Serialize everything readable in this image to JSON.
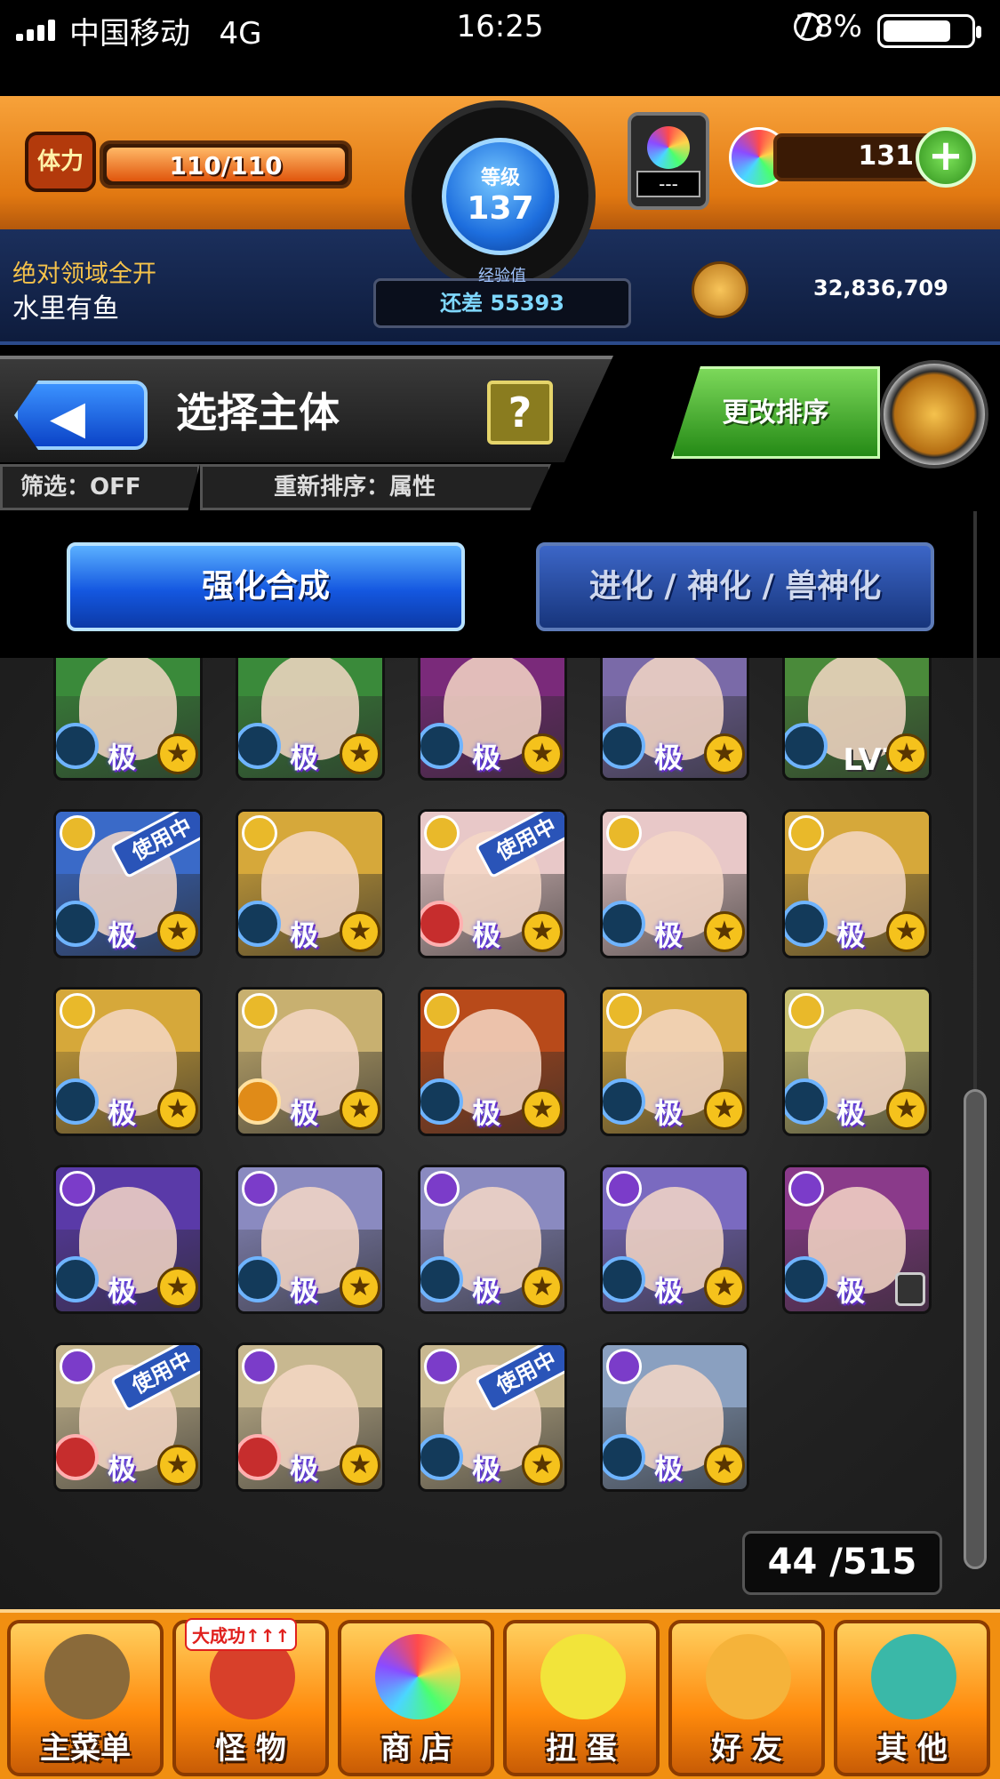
{
  "status_bar": {
    "carrier": "中国移动",
    "network": "4G",
    "time": "16:25",
    "battery": "78%",
    "battery_level": 0.78
  },
  "header": {
    "stamina_label": "体力",
    "stamina": "110/110",
    "stamina_level": 1.0,
    "rank_label": "等级",
    "rank": "137",
    "exp_label": "经验值",
    "exp_remaining": "还差 55393",
    "guild": "绝对领域全开",
    "player_name": "水里有鱼",
    "orb_box": "---",
    "orb_count": "131",
    "gold": "32,836,709"
  },
  "title_bar": {
    "title": "选择主体",
    "help": "?",
    "filter": "筛选：OFF",
    "sort_order": "重新排序：属性",
    "change_sort": "更改排序"
  },
  "tabs": [
    {
      "label": "强化合成",
      "active": true
    },
    {
      "label": "进化 / 神化 / 兽神化",
      "active": false
    }
  ],
  "monsters": [
    {
      "elem": "none",
      "color": "#3a8a3a",
      "lucky": "blue",
      "ji": "极",
      "inuse": false,
      "lv": ""
    },
    {
      "elem": "none",
      "color": "#3a8a3a",
      "lucky": "blue",
      "ji": "极",
      "inuse": false,
      "lv": ""
    },
    {
      "elem": "none",
      "color": "#7a2a7a",
      "lucky": "blue",
      "ji": "极",
      "inuse": false,
      "lv": ""
    },
    {
      "elem": "none",
      "color": "#7a6aa8",
      "lucky": "blue",
      "ji": "极",
      "inuse": false,
      "lv": ""
    },
    {
      "elem": "none",
      "color": "#4a8a3a",
      "lucky": "blue",
      "ji": "",
      "inuse": false,
      "lv": "LV70"
    },
    {
      "elem": "light",
      "color": "#3a6ac8",
      "lucky": "blue",
      "ji": "极",
      "inuse": true,
      "lv": ""
    },
    {
      "elem": "light",
      "color": "#d6a83a",
      "lucky": "blue",
      "ji": "极",
      "inuse": false,
      "lv": ""
    },
    {
      "elem": "light",
      "color": "#e8c8c8",
      "lucky": "fruit",
      "ji": "极",
      "inuse": true,
      "lv": ""
    },
    {
      "elem": "light",
      "color": "#e8c8c8",
      "lucky": "blue",
      "ji": "极",
      "inuse": false,
      "lv": ""
    },
    {
      "elem": "light",
      "color": "#d6a83a",
      "lucky": "blue",
      "ji": "极",
      "inuse": false,
      "lv": ""
    },
    {
      "elem": "light",
      "color": "#d6a83a",
      "lucky": "blue",
      "ji": "极",
      "inuse": false,
      "lv": ""
    },
    {
      "elem": "light",
      "color": "#c8b070",
      "lucky": "pear",
      "ji": "极",
      "inuse": false,
      "lv": ""
    },
    {
      "elem": "light",
      "color": "#b84a1a",
      "lucky": "blue",
      "ji": "极",
      "inuse": false,
      "lv": ""
    },
    {
      "elem": "light",
      "color": "#d6a83a",
      "lucky": "blue",
      "ji": "极",
      "inuse": false,
      "lv": ""
    },
    {
      "elem": "light",
      "color": "#c8c070",
      "lucky": "blue",
      "ji": "极",
      "inuse": false,
      "lv": ""
    },
    {
      "elem": "dark",
      "color": "#5a3aa8",
      "lucky": "blue",
      "ji": "极",
      "inuse": false,
      "lv": ""
    },
    {
      "elem": "dark",
      "color": "#8a8ac0",
      "lucky": "blue",
      "ji": "极",
      "inuse": false,
      "lv": ""
    },
    {
      "elem": "dark",
      "color": "#8a8ac0",
      "lucky": "blue",
      "ji": "极",
      "inuse": false,
      "lv": ""
    },
    {
      "elem": "dark",
      "color": "#7a6ac0",
      "lucky": "blue",
      "ji": "极",
      "inuse": false,
      "lv": ""
    },
    {
      "elem": "dark",
      "color": "#8a3a8a",
      "lucky": "blue",
      "ji": "极",
      "inuse": false,
      "lv": "",
      "locked": true
    },
    {
      "elem": "dark",
      "color": "#c8b890",
      "lucky": "fruit",
      "ji": "极",
      "inuse": true,
      "lv": ""
    },
    {
      "elem": "dark",
      "color": "#c8b890",
      "lucky": "fruit",
      "ji": "极",
      "inuse": false,
      "lv": ""
    },
    {
      "elem": "dark",
      "color": "#c8b890",
      "lucky": "blue",
      "ji": "极",
      "inuse": true,
      "lv": ""
    },
    {
      "elem": "dark",
      "color": "#8aa0c0",
      "lucky": "blue",
      "ji": "极",
      "inuse": false,
      "lv": ""
    }
  ],
  "inuse_label": "使用中",
  "box_count": "44 /515",
  "bottom_nav": [
    {
      "label": "主菜单",
      "icon": "gate-icon"
    },
    {
      "label": "怪 物",
      "icon": "monster-icon",
      "badge": "大成功↑↑↑"
    },
    {
      "label": "商 店",
      "icon": "orb-icon"
    },
    {
      "label": "扭 蛋",
      "icon": "egg-icon"
    },
    {
      "label": "好 友",
      "icon": "friend-icon"
    },
    {
      "label": "其 他",
      "icon": "question-icon"
    }
  ]
}
